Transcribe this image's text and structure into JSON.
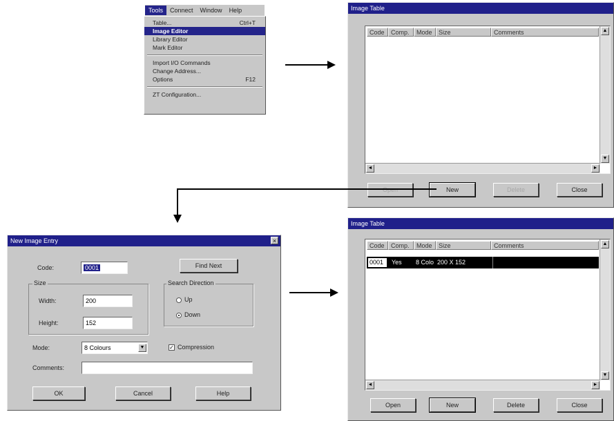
{
  "menu": {
    "bar": [
      "Tools",
      "Connect",
      "Window",
      "Help"
    ],
    "items": [
      {
        "label": "Table...",
        "shortcut": "Ctrl+T"
      },
      {
        "label": "Image Editor",
        "shortcut": ""
      },
      {
        "label": "Library Editor",
        "shortcut": ""
      },
      {
        "label": "Mark Editor",
        "shortcut": ""
      },
      {
        "label": "Import I/O Commands",
        "shortcut": ""
      },
      {
        "label": "Change Address...",
        "shortcut": ""
      },
      {
        "label": "Options",
        "shortcut": "F12"
      },
      {
        "label": "ZT Configuration...",
        "shortcut": ""
      }
    ]
  },
  "table1": {
    "title": "Image Table",
    "columns": [
      "Code",
      "Comp.",
      "Mode",
      "Size",
      "Comments"
    ],
    "buttons": {
      "open": "Open",
      "new": "New",
      "delete": "Delete",
      "close": "Close"
    }
  },
  "table2": {
    "title": "Image Table",
    "columns": [
      "Code",
      "Comp.",
      "Mode",
      "Size",
      "Comments"
    ],
    "row": {
      "code": "0001",
      "comp": "Yes",
      "mode": "8 Colo",
      "size": "200 X 152"
    },
    "buttons": {
      "open": "Open",
      "new": "New",
      "delete": "Delete",
      "close": "Close"
    }
  },
  "dialog": {
    "title": "New Image Entry",
    "close_glyph": "×",
    "code_label": "Code:",
    "code_value": "0001",
    "find_next": "Find Next",
    "size_group": "Size",
    "width_label": "Width:",
    "width_value": "200",
    "height_label": "Height:",
    "height_value": "152",
    "search_group": "Search Direction",
    "radio_up": "Up",
    "radio_down": "Down",
    "mode_label": "Mode:",
    "mode_value": "8 Colours",
    "compression": "Compression",
    "comments_label": "Comments:",
    "comments_value": "",
    "ok": "OK",
    "cancel": "Cancel",
    "help": "Help"
  },
  "icons": {
    "scroll_up": "▲",
    "scroll_down": "▼",
    "scroll_left": "◄",
    "scroll_right": "►",
    "dropdown": "▼",
    "check": "✓"
  },
  "colors": {
    "titlebar": "#20208a",
    "selection": "#24248a",
    "window_face": "#c8c8c8"
  }
}
